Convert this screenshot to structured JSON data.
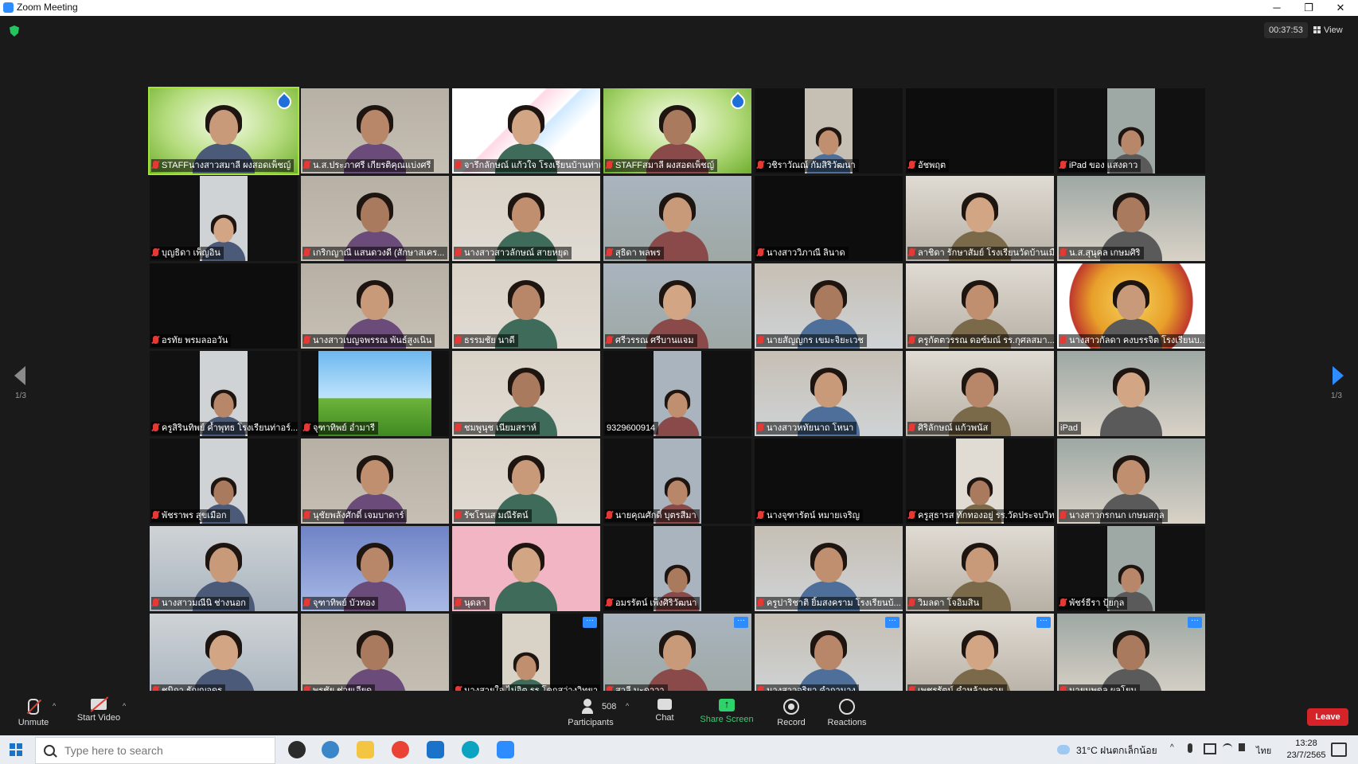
{
  "window": {
    "title": "Zoom Meeting",
    "minimize": "─",
    "restore": "❐",
    "close": "✕"
  },
  "meeting": {
    "timer": "00:37:53",
    "view_label": "View",
    "page_left": "1/3",
    "page_right": "1/3"
  },
  "participants": [
    {
      "name": "STAFFนางสาวสมาลี ผงสอดเพ็ชญ์",
      "kind": "staff",
      "active": true
    },
    {
      "name": "น.ส.ประภาศรี เกียรติคุณแบ่งศรี",
      "kind": "photo"
    },
    {
      "name": "จารึกลักษณ์ แก้วใจ โรงเรียนบ้านท่าแพ",
      "kind": "design"
    },
    {
      "name": "STAFFสมาลี ผงสอดเพ็ชญ์",
      "kind": "staff"
    },
    {
      "name": "วชิราวัณณ์ กัมสิริวัฒนา",
      "kind": "small"
    },
    {
      "name": "อัชพฤต",
      "kind": "black"
    },
    {
      "name": "iPad ของ แสงดาว",
      "kind": "small"
    },
    {
      "name": "บุญธิดา เพ็ญอิน",
      "kind": "small"
    },
    {
      "name": "เกริกญาณี แสนดวงดี (สักษาสเคร...",
      "kind": "photo"
    },
    {
      "name": "นางสาวสาวลักษณ์ สายหยุด",
      "kind": "photo"
    },
    {
      "name": "สุธิดา พลพร",
      "kind": "photo"
    },
    {
      "name": "นางสาววิภาณี ลินาด",
      "kind": "black"
    },
    {
      "name": "ลาชิดา รักษาสัมย์ โรงเรียนวัดบ้านเมือง...",
      "kind": "photo"
    },
    {
      "name": "น.ส.สุนุคล เกษมศิริ",
      "kind": "photo"
    },
    {
      "name": "อรทัย พรมลออวัน",
      "kind": "black"
    },
    {
      "name": "นางสาวเบญจพรรณ พันธ์สูงเนิน",
      "kind": "photo"
    },
    {
      "name": "ธรรมชัย นาดี",
      "kind": "photo"
    },
    {
      "name": "ศรีวรรณ ศรีบานแจม",
      "kind": "photo"
    },
    {
      "name": "นายสัญญกร เขมะจิยะเวช",
      "kind": "photo"
    },
    {
      "name": "ครูกัตตวรรณ ดอซ์มณ์ รร.กุศลสมา...",
      "kind": "photo"
    },
    {
      "name": "นางสาวกัลดา คงบรรจิต โรงเรียนบ...",
      "kind": "emblem"
    },
    {
      "name": "ครูสิรินทิพย์ ค้ำพุทธ โรงเรียนท่าอร์...",
      "kind": "small"
    },
    {
      "name": "จุฑาทิพย์ อ่ำมารี",
      "kind": "landscape"
    },
    {
      "name": "ชมพูนุช เนียมสราห์",
      "kind": "photo"
    },
    {
      "name": "9329600914",
      "kind": "small"
    },
    {
      "name": "นางสาวหทัยนาถ โหนา",
      "kind": "photo"
    },
    {
      "name": "ศิริลักษณ์ แก้วพนัส",
      "kind": "photo"
    },
    {
      "name": "iPad",
      "kind": "photo"
    },
    {
      "name": "พัชราพร สุขเมือก",
      "kind": "small"
    },
    {
      "name": "นุชัยพลังศักดิ์ เจมบาดาร์",
      "kind": "photo"
    },
    {
      "name": "รัชโรนส มณีรัตน์",
      "kind": "photo"
    },
    {
      "name": "นายคุณศักดิ์ บุตรสีมา",
      "kind": "small"
    },
    {
      "name": "นางจุฑารัตน์ หมายเจริญ",
      "kind": "black"
    },
    {
      "name": "ครูสุธารส ทักทองอยู่ รร.วัดประจบวิท...",
      "kind": "small"
    },
    {
      "name": "นางสาวกรกนก เกษมสกุล",
      "kind": "photo"
    },
    {
      "name": "นางสาวมณีนิ ช่างนอก",
      "kind": "photo"
    },
    {
      "name": "จุฑาทิพย์ บัวทอง",
      "kind": "night"
    },
    {
      "name": "นุดลา",
      "kind": "pink"
    },
    {
      "name": "อมรรัตน์ เพ็งศิริวัฒนา",
      "kind": "small"
    },
    {
      "name": "ครูปาริชาติ ยิ้มสงคราม โรงเรียนบ้...",
      "kind": "photo"
    },
    {
      "name": "วิมลดา โจอิมสิน",
      "kind": "photo"
    },
    {
      "name": "พัชร์ธีรา ปุ้ยกุล",
      "kind": "small"
    },
    {
      "name": "ชนิกา ธัญญอุดร",
      "kind": "photo"
    },
    {
      "name": "พรชัย ช่วยเอียด",
      "kind": "photo"
    },
    {
      "name": "นางสายใจ ไม่จิต รร.โคกสว่างวิทยา",
      "kind": "small",
      "dots": true
    },
    {
      "name": "สวลี มะดาวา",
      "kind": "photo",
      "dots": true
    },
    {
      "name": "นางสาวอริยา คำกานาง",
      "kind": "photo",
      "dots": true
    },
    {
      "name": "เพชรรัตน์ คำหล้าพราย",
      "kind": "photo",
      "dots": true
    },
    {
      "name": "นายนพดล ผลโยม",
      "kind": "photo",
      "dots": true
    }
  ],
  "toolbar": {
    "unmute": "Unmute",
    "start_video": "Start Video",
    "participants_label": "Participants",
    "participants_count": "508",
    "chat": "Chat",
    "share_screen": "Share Screen",
    "record": "Record",
    "reactions": "Reactions",
    "leave": "Leave"
  },
  "taskbar": {
    "search_placeholder": "Type here to search",
    "weather": "31°C ฝนตกเล็กน้อย",
    "lang": "ไทย",
    "time": "13:28",
    "date": "23/7/2565"
  },
  "colors": {
    "accent": "#2d8cff",
    "share_green": "#2fd26a",
    "leave_red": "#d4242a",
    "mute_red": "#e53935"
  }
}
